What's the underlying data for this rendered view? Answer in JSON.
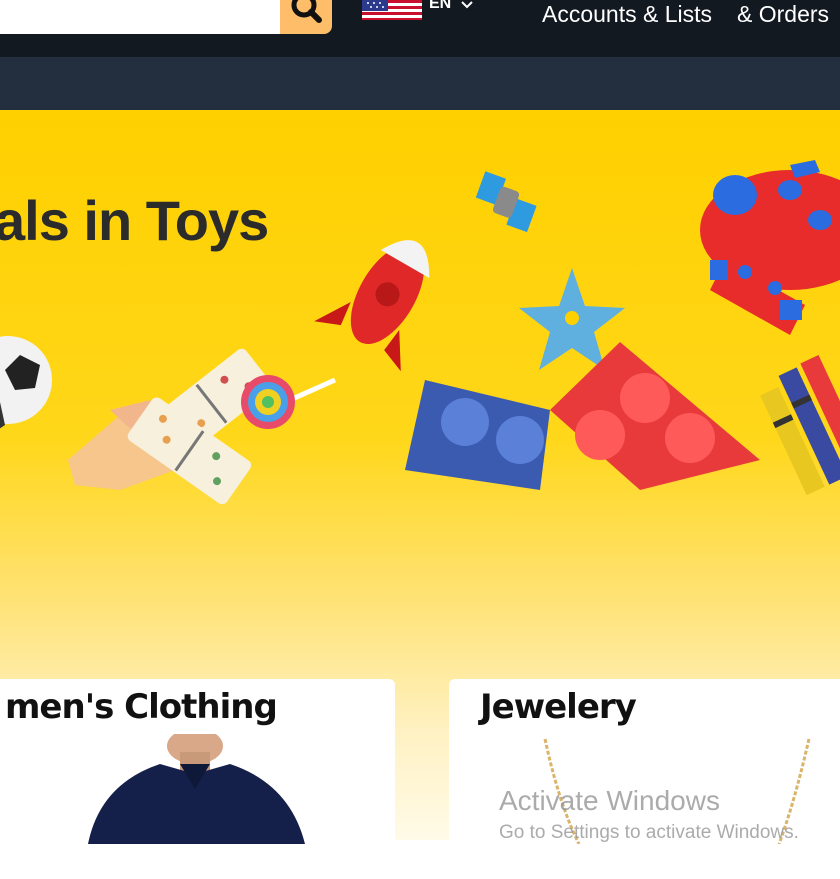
{
  "header": {
    "language": "EN",
    "accounts_label": "Accounts & Lists",
    "orders_label": "& Orders"
  },
  "hero": {
    "title": "als in Toys"
  },
  "cards": [
    {
      "title": "men's Clothing"
    },
    {
      "title": "Jewelery"
    }
  ],
  "watermark": {
    "line1": "Activate Windows",
    "line2": "Go to Settings to activate Windows."
  },
  "colors": {
    "header_bg": "#131921",
    "subnav_bg": "#232f3e",
    "search_button": "#febd69",
    "hero_yellow": "#ffd000"
  },
  "icons": [
    "search-icon",
    "us-flag-icon",
    "chevron-down-icon"
  ]
}
